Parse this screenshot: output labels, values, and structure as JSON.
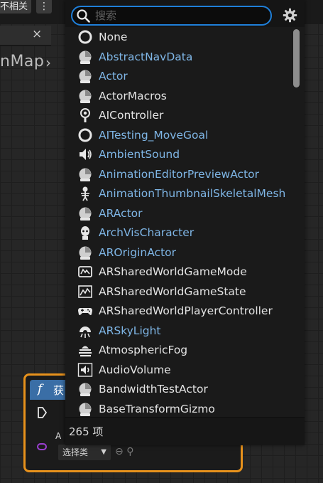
{
  "background": {
    "toolbar_button": "不相关",
    "kebab": "⋮",
    "tab_close": "×",
    "title_fragment": "nMap",
    "node": {
      "header_title": "获",
      "pin_label": "A",
      "class_select": "选择类"
    }
  },
  "search": {
    "placeholder": "搜索",
    "value": ""
  },
  "items": [
    {
      "label": "None",
      "type": "native",
      "icon": "circle-icon"
    },
    {
      "label": "AbstractNavData",
      "type": "bp",
      "icon": "actor-icon"
    },
    {
      "label": "Actor",
      "type": "bp",
      "icon": "actor-icon"
    },
    {
      "label": "ActorMacros",
      "type": "native",
      "icon": "actor-icon"
    },
    {
      "label": "AIController",
      "type": "native",
      "icon": "ai-controller-icon"
    },
    {
      "label": "AITesting_MoveGoal",
      "type": "bp",
      "icon": "circle-icon"
    },
    {
      "label": "AmbientSound",
      "type": "bp",
      "icon": "speaker-icon"
    },
    {
      "label": "AnimationEditorPreviewActor",
      "type": "bp",
      "icon": "actor-icon"
    },
    {
      "label": "AnimationThumbnailSkeletalMeshActor",
      "type": "bp",
      "icon": "skeleton-icon"
    },
    {
      "label": "ARActor",
      "type": "bp",
      "icon": "actor-icon"
    },
    {
      "label": "ArchVisCharacter",
      "type": "bp",
      "icon": "character-icon"
    },
    {
      "label": "AROriginActor",
      "type": "bp",
      "icon": "actor-icon"
    },
    {
      "label": "ARSharedWorldGameMode",
      "type": "native",
      "icon": "game-mode-icon"
    },
    {
      "label": "ARSharedWorldGameState",
      "type": "native",
      "icon": "game-state-icon"
    },
    {
      "label": "ARSharedWorldPlayerController",
      "type": "native",
      "icon": "gamepad-icon"
    },
    {
      "label": "ARSkyLight",
      "type": "bp",
      "icon": "skylight-icon"
    },
    {
      "label": "AtmosphericFog",
      "type": "native",
      "icon": "fog-icon"
    },
    {
      "label": "AudioVolume",
      "type": "native",
      "icon": "audio-volume-icon"
    },
    {
      "label": "BandwidthTestActor",
      "type": "native",
      "icon": "actor-icon"
    },
    {
      "label": "BaseTransformGizmo",
      "type": "native",
      "icon": "actor-icon"
    }
  ],
  "footer": {
    "count_text": "265 项"
  },
  "colors": {
    "accent": "#1f7fd9",
    "native_text": "#e3e3e3",
    "blueprint_text": "#7fb6e6",
    "node_border": "#e8921c",
    "node_header": "#3a6ea6"
  }
}
